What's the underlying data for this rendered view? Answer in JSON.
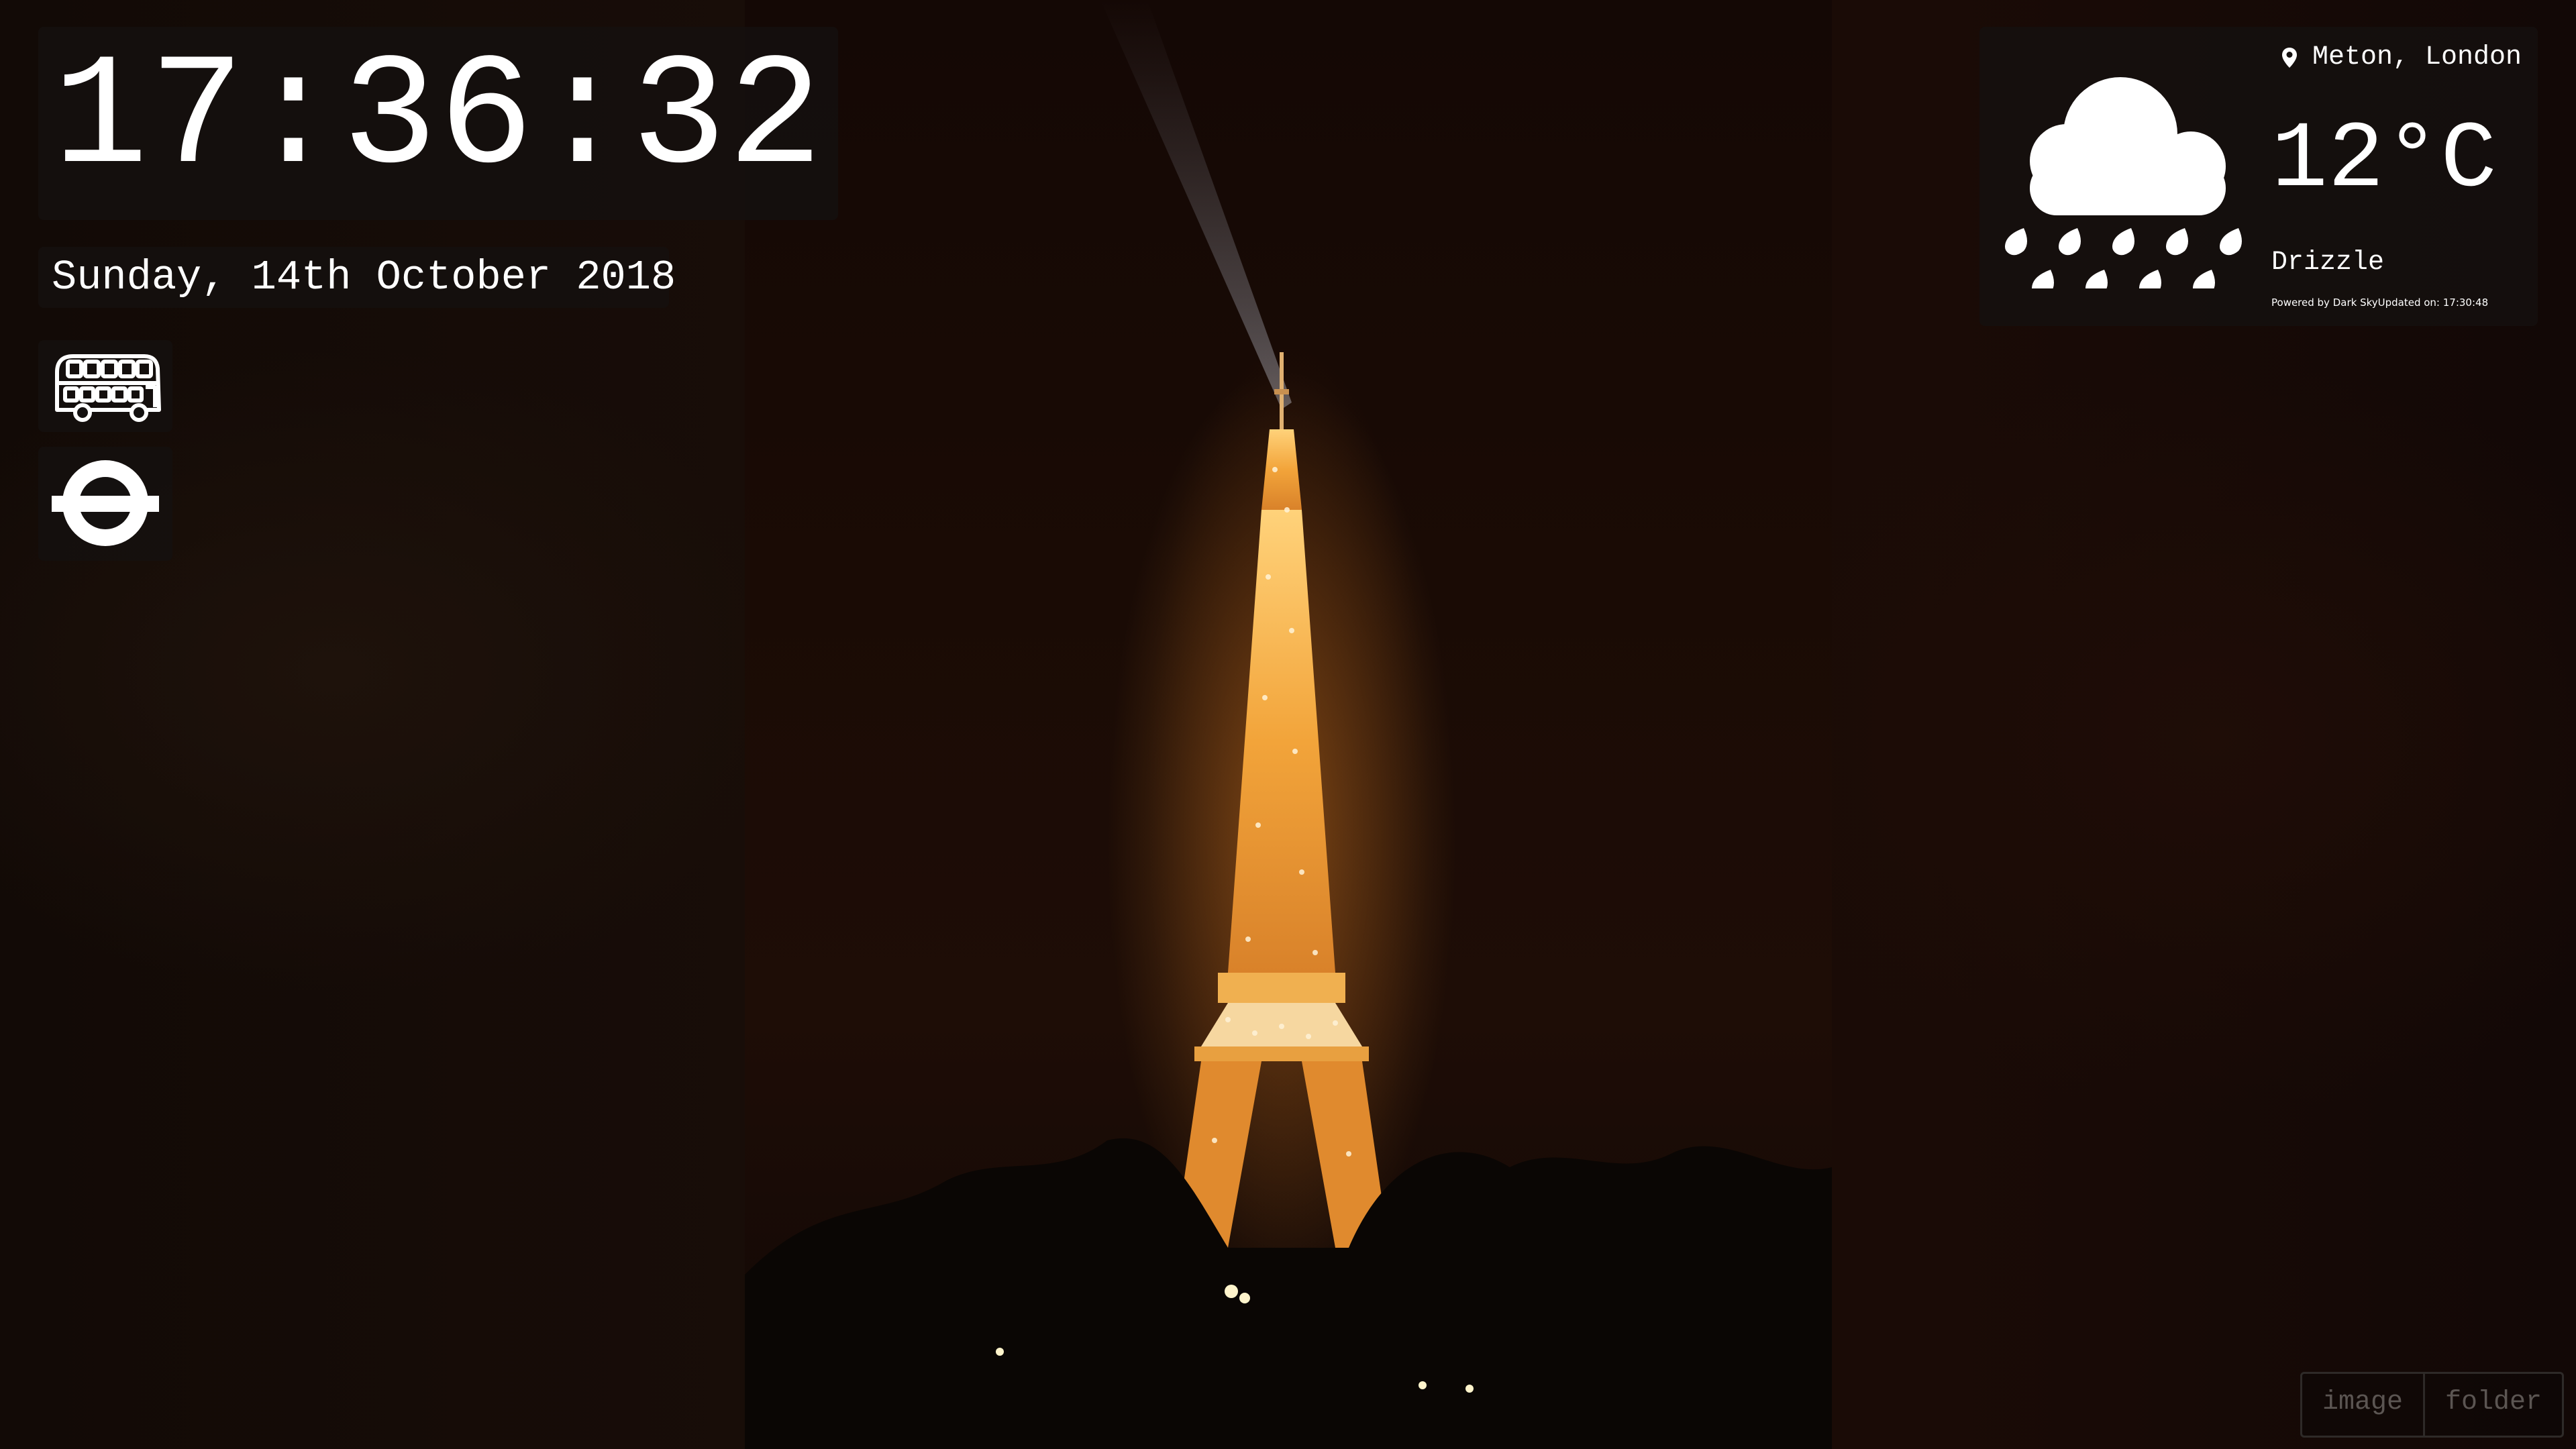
{
  "clock": {
    "time": "17:36:32"
  },
  "date": {
    "text": "Sunday, 14th October 2018"
  },
  "transport": {
    "bus_icon": "double-decker-bus-icon",
    "tube_icon": "london-underground-roundel-icon"
  },
  "weather": {
    "location": "Meton, London",
    "location_icon": "map-pin-icon",
    "temperature": "12°C",
    "summary": "Drizzle",
    "powered_by": "Powered by Dark Sky",
    "updated": "Updated on: 17:30:48",
    "condition_icon": "rain-cloud-icon"
  },
  "background_source": {
    "options": [
      "image",
      "folder"
    ]
  },
  "colors": {
    "panel_bg": "#141110",
    "text": "#ffffff",
    "toggle_text": "#5b5552",
    "tower_glow": "#f0a030"
  }
}
